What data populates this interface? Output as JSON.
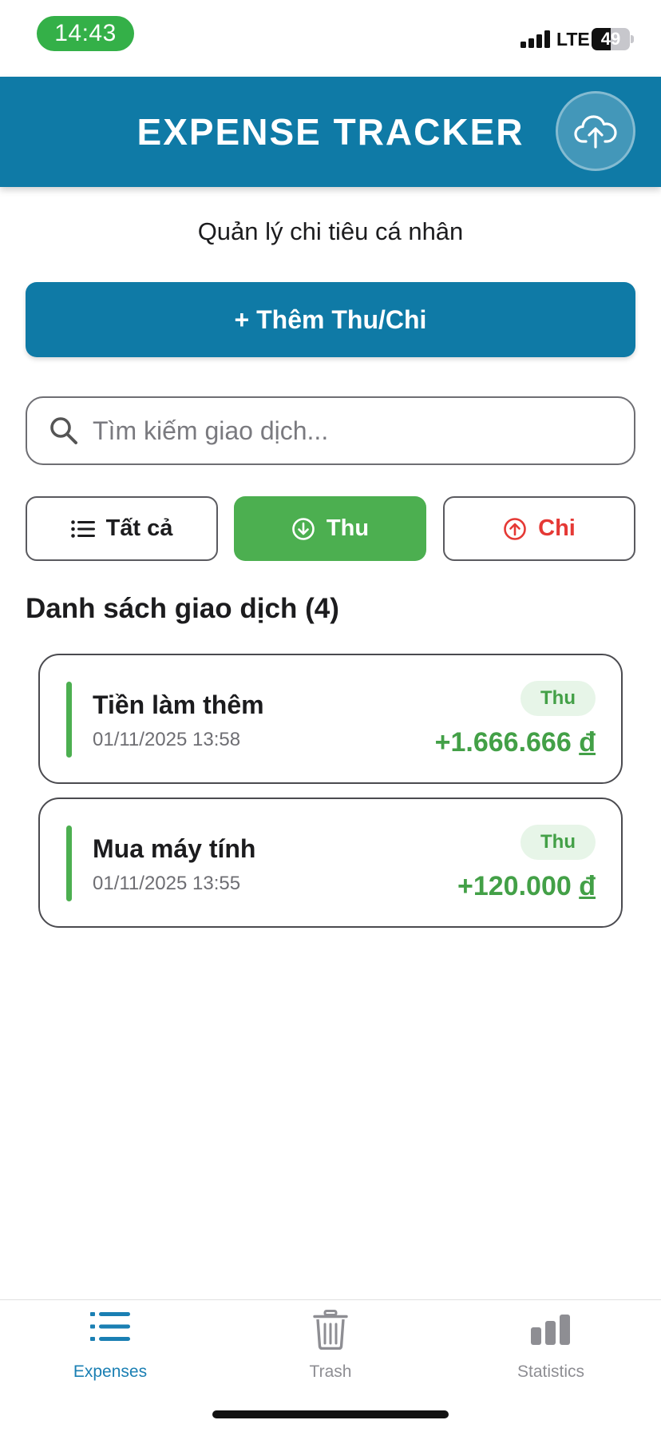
{
  "status_bar": {
    "time": "14:43",
    "network": "LTE",
    "battery": "49",
    "battery_level": 0.49
  },
  "header": {
    "title": "EXPENSE TRACKER",
    "cloud_icon": "cloud-upload-icon"
  },
  "subtitle": "Quản lý chi tiêu cá nhân",
  "add_button": {
    "label": "+ Thêm Thu/Chi"
  },
  "search": {
    "placeholder": "Tìm kiếm giao dịch...",
    "value": ""
  },
  "filters": {
    "all": {
      "label": "Tất cả",
      "icon": "list-icon"
    },
    "income": {
      "label": "Thu",
      "icon": "arrow-down-circle-icon",
      "active": true
    },
    "expense": {
      "label": "Chi",
      "icon": "arrow-up-circle-icon"
    }
  },
  "list": {
    "title": "Danh sách giao dịch (4)",
    "items": [
      {
        "name": "Tiền làm thêm",
        "date": "01/11/2025 13:58",
        "type": "Thu",
        "amount": "+1.666.666",
        "currency": "đ"
      },
      {
        "name": "Mua máy tính",
        "date": "01/11/2025 13:55",
        "type": "Thu",
        "amount": "+120.000",
        "currency": "đ"
      }
    ]
  },
  "bottom_nav": {
    "expenses": {
      "label": "Expenses",
      "icon": "list-icon"
    },
    "trash": {
      "label": "Trash",
      "icon": "trash-icon"
    },
    "statistics": {
      "label": "Statistics",
      "icon": "bar-chart-icon"
    }
  },
  "colors": {
    "primary": "#0f7aa6",
    "income": "#4caf50",
    "expense": "#e53935",
    "time_pill": "#34b048"
  }
}
